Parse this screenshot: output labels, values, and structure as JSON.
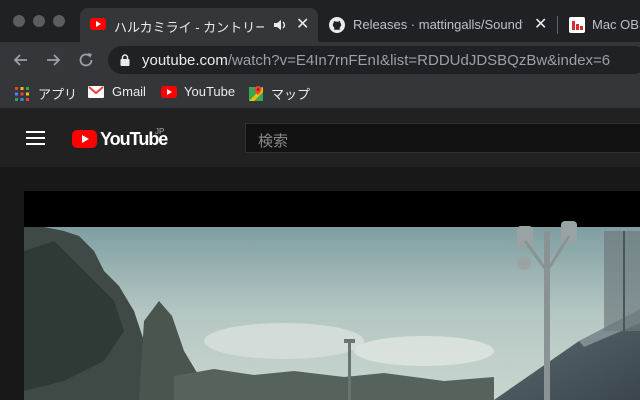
{
  "browser": {
    "tabs": [
      {
        "title": "ハルカミライ - カントリーロー",
        "favicon": "youtube-favicon",
        "active": true
      },
      {
        "title": "Releases · mattingalls/Soundflo",
        "favicon": "github-favicon",
        "active": false
      },
      {
        "title": "Mac OBS",
        "favicon": "red-favicon",
        "active": false
      }
    ],
    "url_host": "youtube.com",
    "url_rest": "/watch?v=E4In7rnFEnI&list=RDDUdJDSBQzBw&index=6",
    "bookmarks": [
      {
        "label": "アプリ",
        "icon": "apps-grid-icon"
      },
      {
        "label": "Gmail",
        "icon": "gmail-icon"
      },
      {
        "label": "YouTube",
        "icon": "youtube-icon"
      },
      {
        "label": "マップ",
        "icon": "maps-icon"
      }
    ]
  },
  "youtube": {
    "logo_text": "YouTube",
    "region": "JP",
    "search_placeholder": "検索"
  },
  "colors": {
    "youtube_red": "#ff0000",
    "chrome_dark": "#202124",
    "chrome_toolbar": "#35363a"
  }
}
